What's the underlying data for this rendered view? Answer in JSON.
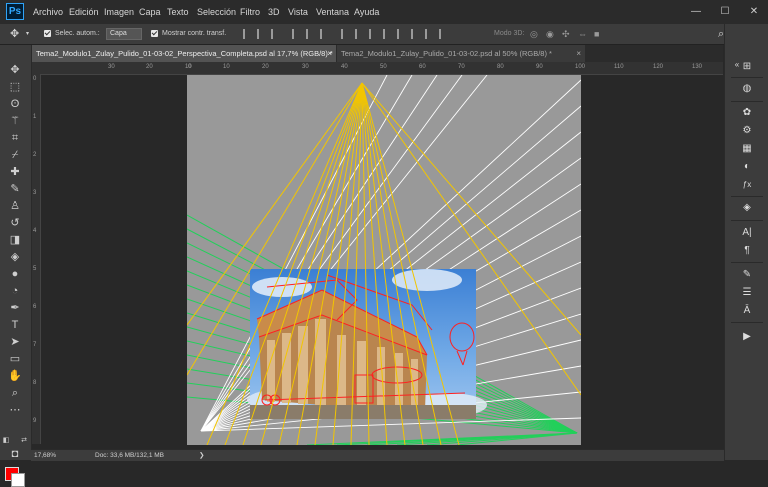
{
  "app": {
    "logo": "Ps"
  },
  "menu": {
    "items": [
      "Archivo",
      "Edición",
      "Imagen",
      "Capa",
      "Texto",
      "Selección",
      "Filtro",
      "3D",
      "Vista",
      "Ventana",
      "Ayuda"
    ]
  },
  "window_controls": {
    "minimize": "—",
    "maximize": "☐",
    "close": "✕"
  },
  "options": {
    "auto_select_label": "Selec. autom.:",
    "auto_select_value": "Capa",
    "show_transform_label": "Mostrar contr. transf.",
    "mode_3d_label": "Modo 3D:",
    "more": "•••"
  },
  "tabs": [
    {
      "label": "Tema2_Modulo1_Zulay_Pulido_01-03-02_Perspectiva_Completa.psd al 17,7% (RGB/8) *",
      "active": true,
      "close": "×"
    },
    {
      "label": "Tema2_Modulo1_Zulay_Pulido_01-03-02.psd al 50% (RGB/8) *",
      "active": false,
      "close": "×"
    }
  ],
  "rulers": {
    "h_ticks": [
      "30",
      "20",
      "10",
      "0",
      "10",
      "20",
      "30",
      "40",
      "50",
      "60",
      "70",
      "80",
      "90",
      "100",
      "110",
      "120",
      "130"
    ],
    "v_ticks": [
      "0",
      "1",
      "2",
      "3",
      "4",
      "5",
      "6",
      "7",
      "8",
      "9"
    ]
  },
  "colors": {
    "foreground": "#ff0000",
    "background": "#ffffff",
    "canvas": "#999999"
  },
  "status": {
    "zoom": "17,68%",
    "doc": "Doc: 33,6 MB/132,1 MB",
    "arrow": "❯"
  }
}
